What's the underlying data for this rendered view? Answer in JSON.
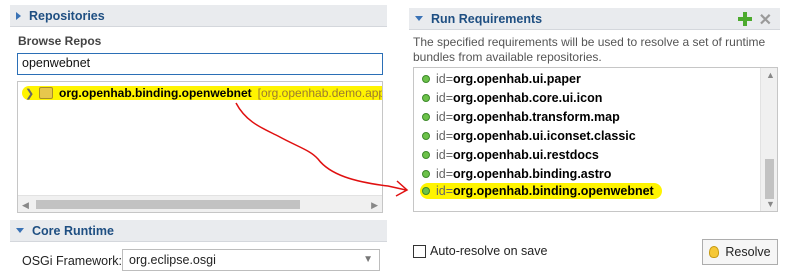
{
  "left": {
    "repositories_label": "Repositories",
    "browse_label": "Browse Repos",
    "search_value": "openwebnet",
    "repo_item": {
      "name": "org.openhab.binding.openwebnet",
      "extra": "[org.openhab.demo.app ("
    },
    "core_runtime_label": "Core Runtime",
    "osgi_label": "OSGi Framework:",
    "osgi_value": "org.eclipse.osgi"
  },
  "right": {
    "run_requirements_label": "Run Requirements",
    "description": "The specified requirements will be used to resolve a set of runtime bundles from available repositories.",
    "items": [
      {
        "prefix": "id=",
        "value": "org.openhab.ui.paper"
      },
      {
        "prefix": "id=",
        "value": "org.openhab.core.ui.icon"
      },
      {
        "prefix": "id=",
        "value": "org.openhab.transform.map"
      },
      {
        "prefix": "id=",
        "value": "org.openhab.ui.iconset.classic"
      },
      {
        "prefix": "id=",
        "value": "org.openhab.ui.restdocs"
      },
      {
        "prefix": "id=",
        "value": "org.openhab.binding.astro"
      },
      {
        "prefix": "id=",
        "value": "org.openhab.binding.openwebnet"
      }
    ],
    "auto_resolve_label": "Auto-resolve on save",
    "resolve_label": "Resolve"
  },
  "colors": {
    "highlight": "#fff400",
    "annotation_arrow": "#e01010",
    "accent": "#1f4f82"
  }
}
